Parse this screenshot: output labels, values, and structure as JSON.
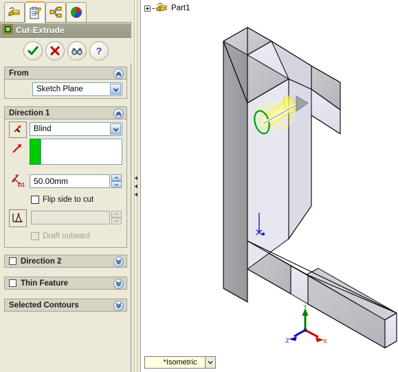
{
  "app": {
    "feature_title": "Cut-Extrude",
    "feature_icon": "cut-extrude-icon"
  },
  "tabs": [
    {
      "name": "feature-manager-tab",
      "icon": "part-tree-icon",
      "active": false
    },
    {
      "name": "property-manager-tab",
      "icon": "clipboard-pencil-icon",
      "active": true
    },
    {
      "name": "configuration-manager-tab",
      "icon": "configuration-tree-icon",
      "active": false
    },
    {
      "name": "display-manager-tab",
      "icon": "colored-cube-icon",
      "active": false
    }
  ],
  "actions": [
    {
      "name": "ok-button",
      "icon": "green-check-icon",
      "tooltip": "OK"
    },
    {
      "name": "cancel-button",
      "icon": "red-x-icon",
      "tooltip": "Cancel"
    },
    {
      "name": "preview-button",
      "icon": "glasses-icon",
      "tooltip": "Detailed Preview"
    },
    {
      "name": "help-button",
      "icon": "question-mark-icon",
      "tooltip": "Help"
    }
  ],
  "groups": {
    "from": {
      "label": "From",
      "collapsed": false,
      "has_checkbox": false,
      "start_condition": "Sketch Plane"
    },
    "direction1": {
      "label": "Direction 1",
      "collapsed": false,
      "has_checkbox": false,
      "reverse_direction_icon": "reverse-direction-icon",
      "end_condition": "Blind",
      "direction_vector_icon": "direction-arrow-icon",
      "direction_vector_value": "",
      "depth_icon": "depth-d1-icon",
      "depth_label": "D1",
      "depth_value": "50.00mm",
      "flip_side_to_cut": {
        "label": "Flip side to cut",
        "checked": false
      },
      "draft_icon": "draft-angle-icon",
      "draft_value": "",
      "draft_enabled": false,
      "draft_outward": {
        "label": "Draft outward",
        "checked": false,
        "enabled": false
      }
    },
    "direction2": {
      "label": "Direction 2",
      "collapsed": true,
      "has_checkbox": true,
      "checked": false
    },
    "thin_feature": {
      "label": "Thin Feature",
      "collapsed": true,
      "has_checkbox": true,
      "checked": false
    },
    "selected_contours": {
      "label": "Selected Contours",
      "collapsed": true,
      "has_checkbox": false
    }
  },
  "graphics": {
    "tree_item": "Part1",
    "tree_icon": "part-icon",
    "view_orientation": "*Isometric",
    "triad": {
      "x_label": "X",
      "y_label": "Y",
      "z_label": "Z"
    }
  },
  "colors": {
    "panel_bg": "#ece9d8",
    "title_bar": "#a0a08e",
    "accent_orange": "#e8a33d",
    "direction_green": "#00cc00",
    "selection_green": "#00a000",
    "preview_yellow": "#ffff66",
    "model_face_light": "#e8e8f2",
    "model_face_mid": "#c8c8cc",
    "model_face_dark": "#9a9a9e",
    "origin_blue": "#2020c0",
    "axis_x": "#cc0000",
    "axis_y": "#008000",
    "axis_z": "#0000cc"
  }
}
